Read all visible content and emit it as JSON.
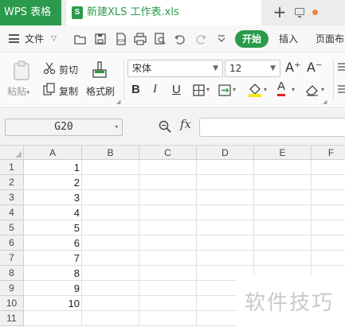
{
  "titlebar": {
    "app_tab": "WPS 表格",
    "doc_tab": "新建XLS 工作表.xls",
    "doc_icon_letter": "S",
    "new_tab_label": "+",
    "unsaved_dot_color": "#f0883a"
  },
  "menubar": {
    "file_label": "文件",
    "start_label": "开始",
    "insert_label": "插入",
    "layout_label": "页面布",
    "accent": "#2b9a4c"
  },
  "ribbon": {
    "paste_label": "粘贴",
    "cut_label": "剪切",
    "copy_label": "复制",
    "painter_label": "格式刷",
    "font_name": "宋体",
    "font_size": "12",
    "grow_font": "A⁺",
    "shrink_font": "A⁻",
    "bold": "B",
    "italic": "I",
    "underline": "U",
    "font_color_letter": "A"
  },
  "formulabar": {
    "cell_ref": "G20",
    "fx": "fx",
    "formula": ""
  },
  "sheet": {
    "columns": [
      "A",
      "B",
      "C",
      "D",
      "E",
      "F"
    ],
    "rows": [
      "1",
      "2",
      "3",
      "4",
      "5",
      "6",
      "7",
      "8",
      "9",
      "10",
      "11"
    ],
    "col_a_values": [
      "1",
      "2",
      "3",
      "4",
      "5",
      "6",
      "7",
      "8",
      "9",
      "10",
      ""
    ]
  },
  "watermark": "软件技巧"
}
